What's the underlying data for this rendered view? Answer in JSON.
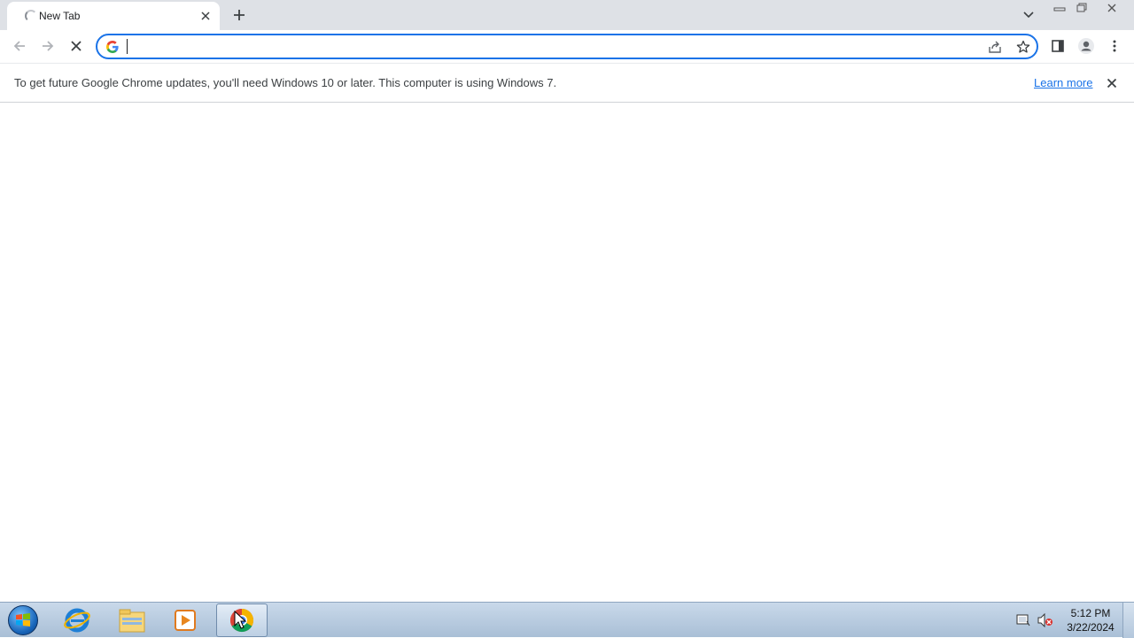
{
  "browser": {
    "tab": {
      "title": "New Tab",
      "state": "loading"
    },
    "omnibox": {
      "value": "",
      "placeholder": ""
    },
    "infobar": {
      "message": "To get future Google Chrome updates, you'll need Windows 10 or later. This computer is using Windows 7.",
      "link_label": "Learn more"
    },
    "icons": [
      "back-icon",
      "forward-icon",
      "stop-icon",
      "share-icon",
      "star-icon",
      "side-panel-icon",
      "profile-icon",
      "menu-icon"
    ],
    "accent_color": "#1a73e8"
  },
  "taskbar": {
    "apps": [
      "internet-explorer",
      "windows-explorer",
      "media-player",
      "google-chrome"
    ],
    "active_app": "google-chrome",
    "clock": {
      "time": "5:12 PM",
      "date": "3/22/2024"
    }
  }
}
